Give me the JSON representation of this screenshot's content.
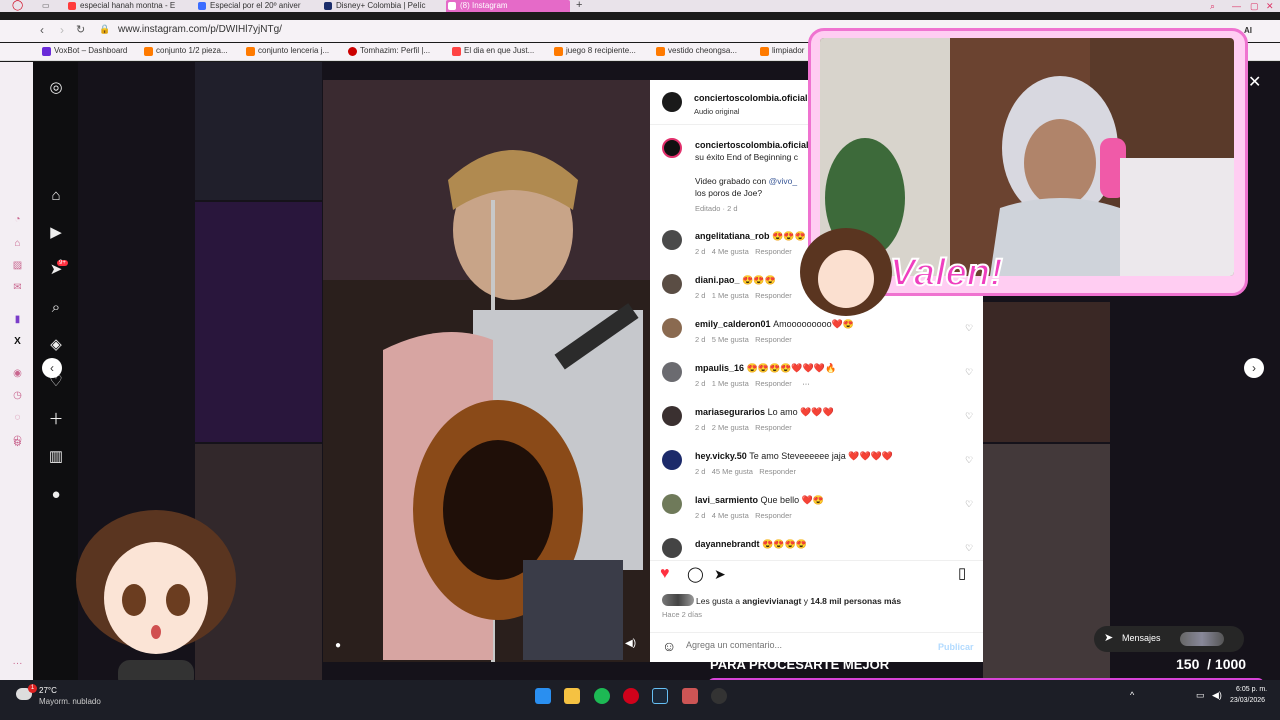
{
  "browser": {
    "tabs": [
      {
        "label": "especial hanah montna - E",
        "icon_color": "#ff3b3b"
      },
      {
        "label": "Especial por el 20º aniver",
        "icon_color": "#3b6cff"
      },
      {
        "label": "Disney+ Colombia | Pelíc",
        "icon_color": "#1b2d6b"
      },
      {
        "label": "(8) Instagram",
        "icon_color": "#e1306c",
        "active": true
      }
    ],
    "new_tab": "+",
    "url": "www.instagram.com/p/DWIHl7yjNTg/",
    "ai_label": "AI",
    "bookmarks": [
      {
        "label": "VoxBot – Dashboard",
        "icon_color": "#6a2bd9"
      },
      {
        "label": "conjunto 1/2 pieza...",
        "icon_color": "#ff7a00"
      },
      {
        "label": "conjunto lenceria j...",
        "icon_color": "#ff7a00"
      },
      {
        "label": "Tomhazim: Perfil |...",
        "icon_color": "#c00"
      },
      {
        "label": "El dia en que Just...",
        "icon_color": "#ff4444"
      },
      {
        "label": "juego 8 recipiente...",
        "icon_color": "#ff7a00"
      },
      {
        "label": "vestido cheongsa...",
        "icon_color": "#ff7a00"
      },
      {
        "label": "limpiador",
        "icon_color": "#ff7a00"
      }
    ]
  },
  "post": {
    "author": "conciertoscolombia.oficial",
    "audio": "Audio original",
    "caption_author": "conciertoscolombia.oficial",
    "caption_line1": "su éxito End of Beginning c",
    "caption_line2_pre": "Video grabado con ",
    "caption_line2_link": "@vivo_",
    "caption_line3": "los poros de Joe?",
    "caption_meta": "Editado · 2 d",
    "comments": [
      {
        "user": "angelitatiana_rob",
        "text": "😍😍😍",
        "time": "2 d",
        "likes": "4 Me gusta",
        "reply": "Responder",
        "avatar_color": "#4a4a4a"
      },
      {
        "user": "diani.pao_",
        "text": "😍😍😍",
        "time": "2 d",
        "likes": "1 Me gusta",
        "reply": "Responder",
        "avatar_color": "#5a4d44"
      },
      {
        "user": "emily_calderon01",
        "text": "Amooooooooo❤️😍",
        "time": "2 d",
        "likes": "5 Me gusta",
        "reply": "Responder",
        "avatar_color": "#8a6a50"
      },
      {
        "user": "mpaulis_16",
        "text": "😍😍😍😍❤️❤️❤️🔥",
        "time": "2 d",
        "likes": "1 Me gusta",
        "reply": "Responder",
        "more": "···",
        "avatar_color": "#6b6b70"
      },
      {
        "user": "mariasegurarios",
        "text": "Lo amo ❤️❤️❤️",
        "time": "2 d",
        "likes": "2 Me gusta",
        "reply": "Responder",
        "avatar_color": "#3a3030"
      },
      {
        "user": "hey.vicky.50",
        "text": "Te amo Steveeeeee jaja ❤️❤️❤️❤️",
        "time": "2 d",
        "likes": "45 Me gusta",
        "reply": "Responder",
        "avatar_color": "#1c2a6a"
      },
      {
        "user": "lavi_sarmiento",
        "text": "Que bello ❤️😍",
        "time": "2 d",
        "likes": "4 Me gusta",
        "reply": "Responder",
        "avatar_color": "#6f7a5a"
      },
      {
        "user": "dayannebrandt",
        "text": "😍😍😍😍",
        "time": "",
        "likes": "",
        "reply": "",
        "avatar_color": "#444"
      }
    ],
    "likes_text_pre": "Les gusta a ",
    "likes_user": "angievivianagt",
    "likes_text_mid": " y ",
    "likes_count": "14.8 mil personas más",
    "posted_ago": "Hace 2 días",
    "comment_placeholder": "Agrega un comentario...",
    "publish": "Publicar"
  },
  "overlay": {
    "streamer_name": "Valen!",
    "banner_text": "PARA PROCESARTE MEJOR",
    "counter_current": "150",
    "counter_sep": "/",
    "counter_total": "1000",
    "messages_label": "Mensajes",
    "notif_badge": "9+",
    "close": "✕"
  },
  "taskbar": {
    "weather_temp": "27°C",
    "weather_desc": "Mayorm. nublado",
    "weather_badge": "1",
    "time": "6:05 p. m.",
    "date": "23/03/2026"
  },
  "colors": {
    "accent_pink": "#ef73d0",
    "like_red": "#ff3040",
    "ig_blue": "#0095f6"
  }
}
